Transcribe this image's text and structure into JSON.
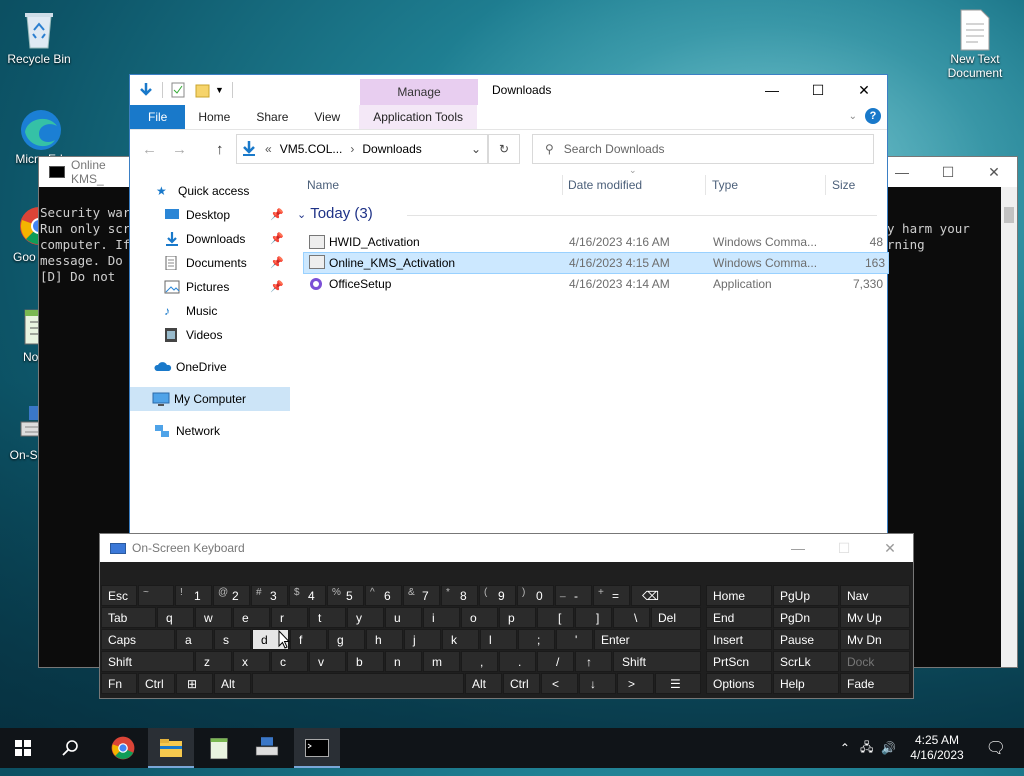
{
  "desktop": {
    "icons": [
      {
        "label": "Recycle Bin"
      },
      {
        "label": "Micro Ed"
      },
      {
        "label": "Goo Chro"
      },
      {
        "label": "Notep"
      },
      {
        "label": "On-S Keyb"
      },
      {
        "label": "New Text Document"
      }
    ]
  },
  "console": {
    "title": "Online KMS_",
    "lines": [
      "Security war",
      "Run only scr",
      "computer. If",
      "message. Do ",
      "[D] Do not "
    ],
    "right_lines": [
      "y harm your",
      "rning"
    ]
  },
  "explorer": {
    "manage_tab": "Manage",
    "title": "Downloads",
    "tabs": [
      "File",
      "Home",
      "Share",
      "View",
      "Application Tools"
    ],
    "address": {
      "prefix": "«",
      "crumbs": [
        "VM5.COL...",
        "Downloads"
      ]
    },
    "search_placeholder": "Search Downloads",
    "nav": [
      {
        "label": "Quick access",
        "pinned": false
      },
      {
        "label": "Desktop",
        "pinned": true
      },
      {
        "label": "Downloads",
        "pinned": true
      },
      {
        "label": "Documents",
        "pinned": true
      },
      {
        "label": "Pictures",
        "pinned": true
      },
      {
        "label": "Music",
        "pinned": false
      },
      {
        "label": "Videos",
        "pinned": false
      },
      {
        "label": "OneDrive",
        "pinned": false
      },
      {
        "label": "My Computer",
        "pinned": false
      },
      {
        "label": "Network",
        "pinned": false
      }
    ],
    "columns": [
      "Name",
      "Date modified",
      "Type",
      "Size"
    ],
    "group": "Today (3)",
    "files": [
      {
        "name": "HWID_Activation",
        "date": "4/16/2023 4:16 AM",
        "type": "Windows Comma...",
        "size": "48"
      },
      {
        "name": "Online_KMS_Activation",
        "date": "4/16/2023 4:15 AM",
        "type": "Windows Comma...",
        "size": "163"
      },
      {
        "name": "OfficeSetup",
        "date": "4/16/2023 4:14 AM",
        "type": "Application",
        "size": "7,330"
      }
    ]
  },
  "osk": {
    "title": "On-Screen Keyboard",
    "row1": [
      {
        "main": "Esc"
      },
      {
        "sub": "~",
        "main": "` 1"
      },
      {
        "sub": "!",
        "main": "1"
      },
      {
        "sub": "@",
        "main": "2"
      },
      {
        "sub": "#",
        "main": "3"
      },
      {
        "sub": "$",
        "main": "4"
      },
      {
        "sub": "%",
        "main": "5"
      },
      {
        "sub": "^",
        "main": "6"
      },
      {
        "sub": "&",
        "main": "7"
      },
      {
        "sub": "*",
        "main": "8"
      },
      {
        "sub": "(",
        "main": "9"
      },
      {
        "sub": ")",
        "main": "0"
      },
      {
        "sub": "_",
        "main": "-"
      },
      {
        "sub": "+",
        "main": "="
      },
      {
        "main": "⌫"
      }
    ],
    "row2": [
      "Tab",
      "q",
      "w",
      "e",
      "r",
      "t",
      "y",
      "u",
      "i",
      "o",
      "p",
      "[",
      "]",
      "\\",
      "Del"
    ],
    "row3": [
      "Caps",
      "a",
      "s",
      "d",
      "f",
      "g",
      "h",
      "j",
      "k",
      "l",
      ";",
      "'",
      "Enter"
    ],
    "row4": [
      "Shift",
      "z",
      "x",
      "c",
      "v",
      "b",
      "n",
      "m",
      ",",
      ".",
      "/",
      "↑",
      "Shift"
    ],
    "row5": [
      "Fn",
      "Ctrl",
      "⊞",
      "Alt",
      "Alt",
      "Ctrl",
      "<",
      "↓",
      ">",
      "☰"
    ],
    "side": [
      [
        "Home",
        "PgUp",
        "Nav"
      ],
      [
        "End",
        "PgDn",
        "Mv Up"
      ],
      [
        "Insert",
        "Pause",
        "Mv Dn"
      ],
      [
        "PrtScn",
        "ScrLk",
        "Dock"
      ],
      [
        "Options",
        "Help",
        "Fade"
      ]
    ]
  },
  "taskbar": {
    "time": "4:25 AM",
    "date": "4/16/2023"
  }
}
